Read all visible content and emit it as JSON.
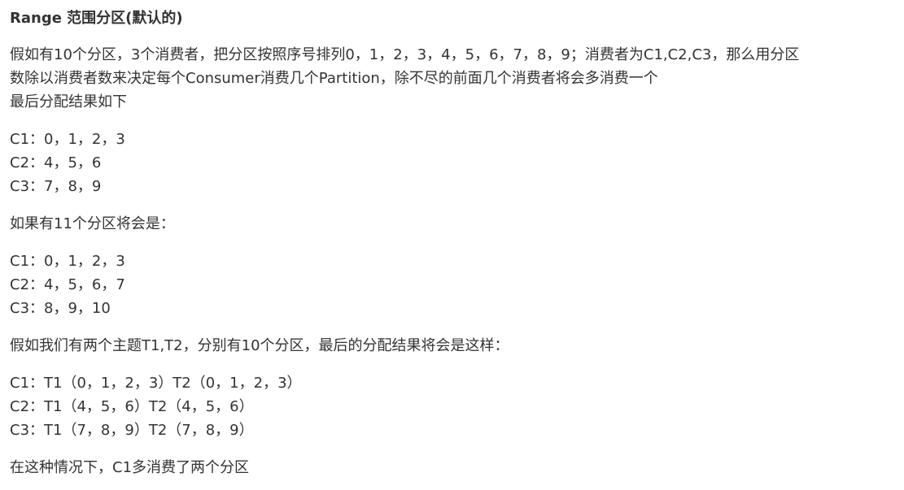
{
  "heading": "Range 范围分区(默认的)",
  "intro": {
    "lines": [
      "假如有10个分区，3个消费者，把分区按照序号排列0，1，2，3，4，5，6，7，8，9；消费者为C1,C2,C3，那么用分区",
      "数除以消费者数来决定每个Consumer消费几个Partition，除不尽的前面几个消费者将会多消费一个",
      "最后分配结果如下"
    ]
  },
  "result_10": [
    "C1：0，1，2，3",
    "C2：4，5，6",
    "C3：7，8，9"
  ],
  "intro_11": "如果有11个分区将会是：",
  "result_11": [
    "C1：0，1，2，3",
    "C2：4，5，6，7",
    "C3：8，9，10"
  ],
  "intro_topics": "假如我们有两个主题T1,T2，分别有10个分区，最后的分配结果将会是这样：",
  "result_topics": [
    "C1：T1（0，1，2，3）T2（0，1，2，3）",
    "C2：T1（4，5，6）T2（4，5，6）",
    "C3：T1（7，8，9）T2（7，8，9）"
  ],
  "conclusion": "在这种情况下，C1多消费了两个分区"
}
